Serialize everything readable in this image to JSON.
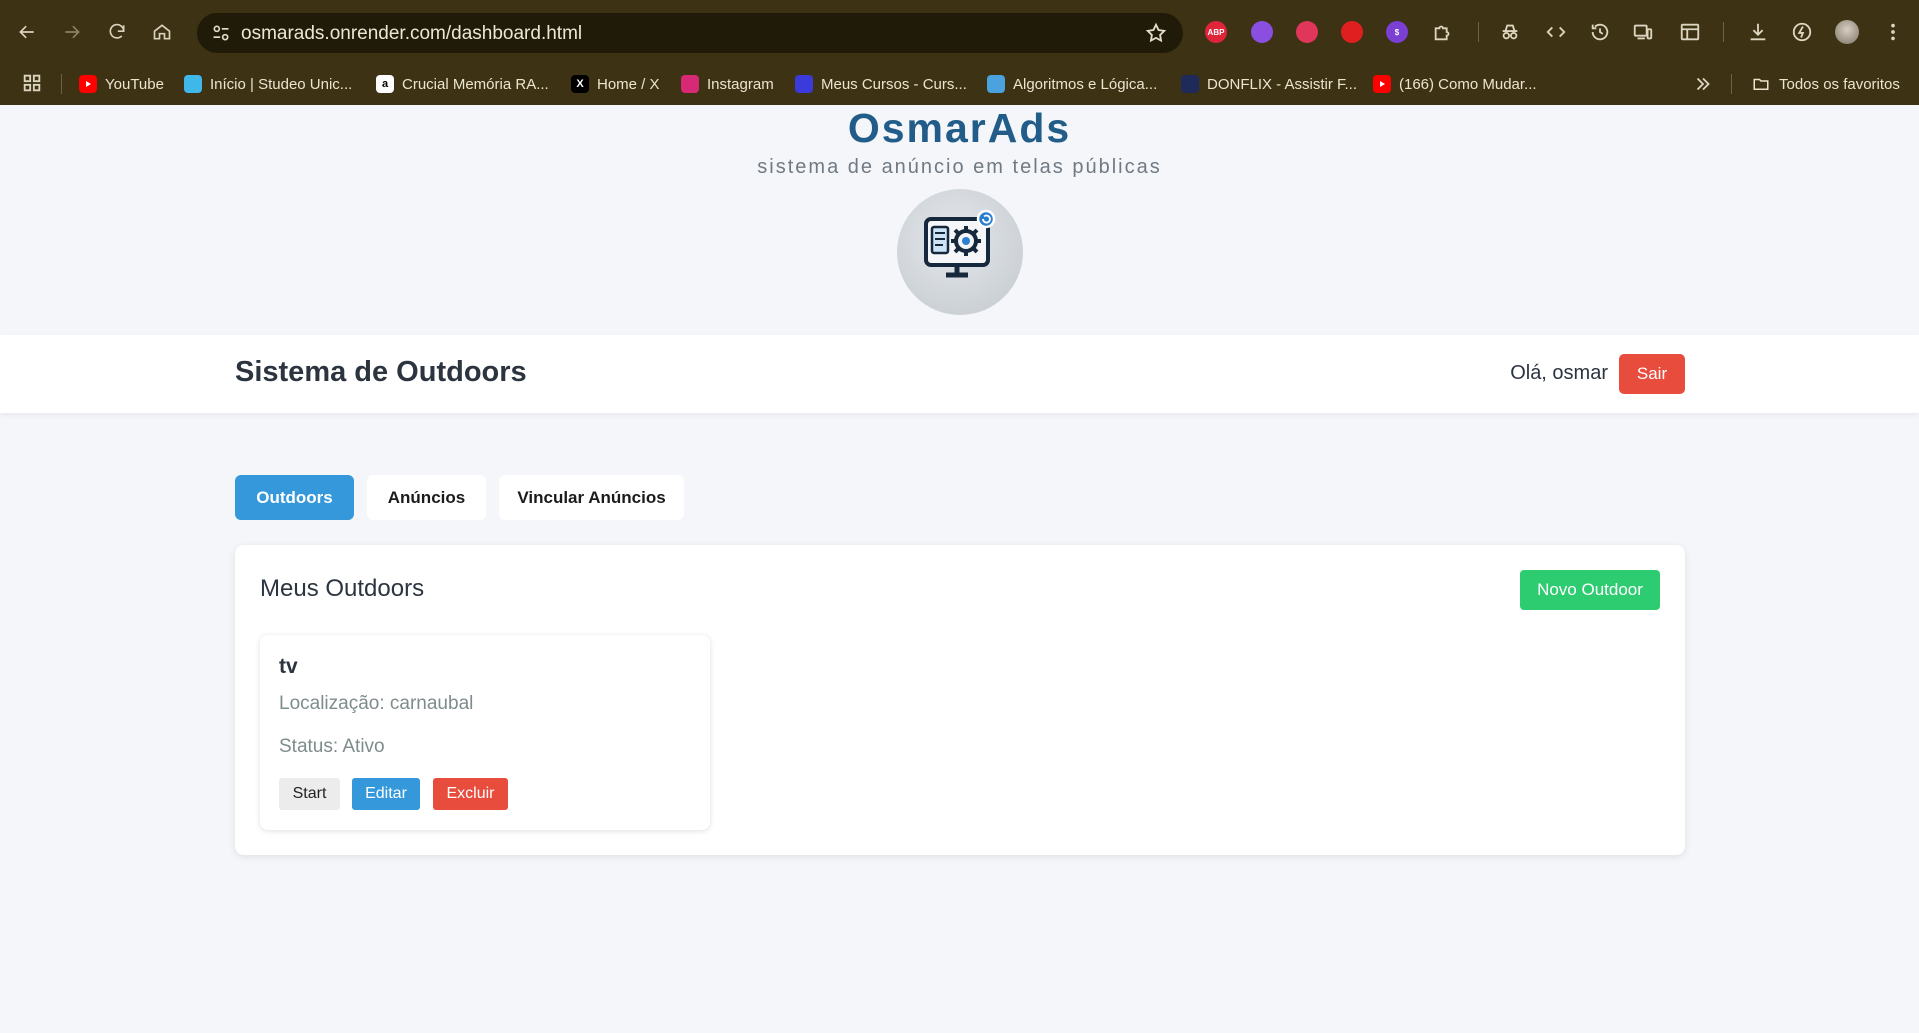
{
  "browser": {
    "url": "osmarads.onrender.com/dashboard.html",
    "bookmarks": [
      {
        "label": "YouTube",
        "icon": "youtube-icon",
        "color": "#ff0000"
      },
      {
        "label": "Início | Studeo Unic...",
        "icon": "studeo-icon",
        "color": "#3fb7e8"
      },
      {
        "label": "Crucial Memória RA...",
        "icon": "amazon-icon",
        "color": "#ffffff"
      },
      {
        "label": "Home / X",
        "icon": "x-icon",
        "color": "#000000"
      },
      {
        "label": "Instagram",
        "icon": "instagram-icon",
        "color": "#d62976"
      },
      {
        "label": "Meus Cursos - Curs...",
        "icon": "courses-icon",
        "color": "#3b3bdb"
      },
      {
        "label": "Algoritmos e Lógica...",
        "icon": "algorithms-icon",
        "color": "#4aa3df"
      },
      {
        "label": "DONFLIX - Assistir F...",
        "icon": "donflix-icon",
        "color": "#1e2a5a"
      },
      {
        "label": "(166) Como Mudar...",
        "icon": "youtube-icon",
        "color": "#ff0000"
      }
    ],
    "all_bookmarks_label": "Todos os favoritos",
    "extensions": [
      {
        "icon": "adblock-icon",
        "text": "ABP",
        "color": "#e0243a"
      },
      {
        "icon": "gear-ext-icon",
        "text": "",
        "color": "#8a4fe0"
      },
      {
        "icon": "profile-ext-icon",
        "text": "",
        "color": "#e0365a"
      },
      {
        "icon": "hand-ext-icon",
        "text": "",
        "color": "#e02020"
      },
      {
        "icon": "dollar-ext-icon",
        "text": "$",
        "color": "#7b3fd4"
      }
    ]
  },
  "brand": {
    "title": "OsmarAds",
    "subtitle": "sistema de anúncio em telas públicas",
    "logo_icon": "monitor-gear-icon"
  },
  "header": {
    "title": "Sistema de Outdoors",
    "greeting": "Olá, osmar",
    "logout_label": "Sair"
  },
  "tabs": [
    {
      "label": "Outdoors",
      "active": true
    },
    {
      "label": "Anúncios",
      "active": false
    },
    {
      "label": "Vincular Anúncios",
      "active": false
    }
  ],
  "panel": {
    "title": "Meus Outdoors",
    "new_button_label": "Novo Outdoor",
    "outdoors": [
      {
        "name": "tv",
        "location": "Localização: carnaubal",
        "status": "Status: Ativo",
        "start_label": "Start",
        "edit_label": "Editar",
        "delete_label": "Excluir"
      }
    ]
  },
  "colors": {
    "primary": "#3498db",
    "danger": "#e74c3c",
    "success": "#2ecc71",
    "brand": "#225d8a"
  }
}
